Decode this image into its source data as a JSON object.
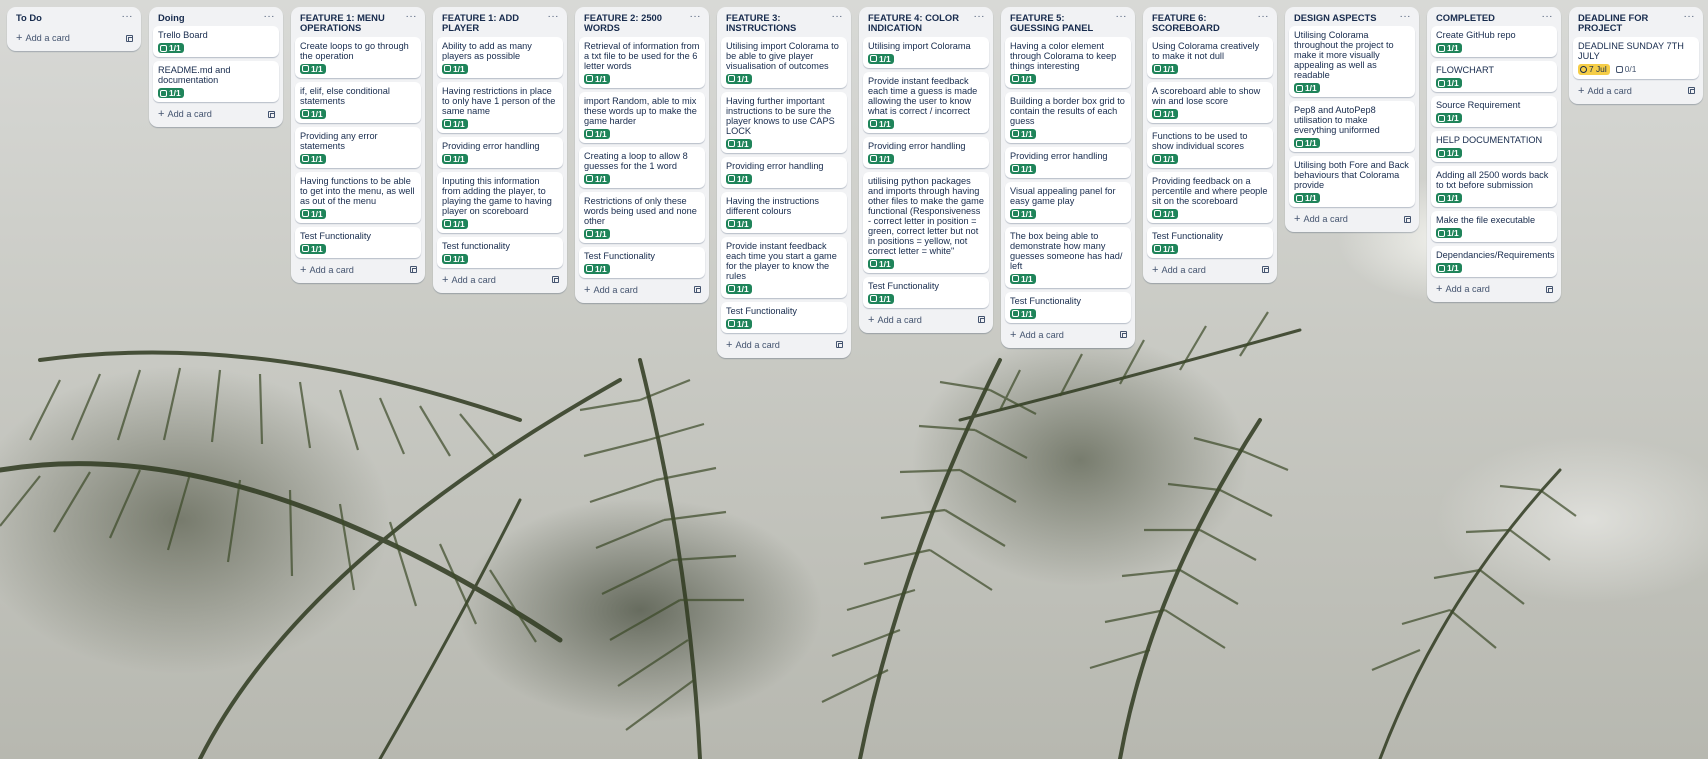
{
  "board": {
    "add_card_label": "Add a card",
    "menu_glyph": "···",
    "lists": [
      {
        "title": "To Do",
        "cards": []
      },
      {
        "title": "Doing",
        "cards": [
          {
            "text": "Trello Board",
            "checklist": "1/1"
          },
          {
            "text": "README.md and documentation",
            "checklist": "1/1"
          }
        ]
      },
      {
        "title": "FEATURE 1: MENU OPERATIONS",
        "cards": [
          {
            "text": "Create loops to go through the operation",
            "checklist": "1/1"
          },
          {
            "text": "if, elif, else conditional statements",
            "checklist": "1/1"
          },
          {
            "text": "Providing any error statements",
            "checklist": "1/1"
          },
          {
            "text": "Having functions to be able to get into the menu, as well as out of the menu",
            "checklist": "1/1"
          },
          {
            "text": "Test Functionality",
            "checklist": "1/1"
          }
        ]
      },
      {
        "title": "FEATURE 1: ADD PLAYER",
        "cards": [
          {
            "text": "Ability to add as many players as possible",
            "checklist": "1/1"
          },
          {
            "text": "Having restrictions in place to only have 1 person of the same name",
            "checklist": "1/1"
          },
          {
            "text": "Providing error handling",
            "checklist": "1/1"
          },
          {
            "text": "Inputing this information from adding the player, to playing the game to having player on scoreboard",
            "checklist": "1/1"
          },
          {
            "text": "Test functionality",
            "checklist": "1/1"
          }
        ]
      },
      {
        "title": "FEATURE 2: 2500 WORDS",
        "cards": [
          {
            "text": "Retrieval of information from a txt file to be used for the 6 letter words",
            "checklist": "1/1"
          },
          {
            "text": "import Random, able to mix these words up to make the game harder",
            "checklist": "1/1"
          },
          {
            "text": "Creating a loop to allow 8 guesses for the 1 word",
            "checklist": "1/1"
          },
          {
            "text": "Restrictions of only these words being used and none other",
            "checklist": "1/1"
          },
          {
            "text": "Test Functionality",
            "checklist": "1/1"
          }
        ]
      },
      {
        "title": "FEATURE 3: INSTRUCTIONS",
        "cards": [
          {
            "text": "Utilising import Colorama to be able to give player visualisation of outcomes",
            "checklist": "1/1"
          },
          {
            "text": "Having further important instructions to be sure the player knows to use CAPS LOCK",
            "checklist": "1/1"
          },
          {
            "text": "Providing error handling",
            "checklist": "1/1"
          },
          {
            "text": "Having the instructions different colours",
            "checklist": "1/1"
          },
          {
            "text": "Provide instant feedback each time you start a game for the player to know the rules",
            "checklist": "1/1"
          },
          {
            "text": "Test Functionality",
            "checklist": "1/1"
          }
        ]
      },
      {
        "title": "FEATURE 4: COLOR INDICATION",
        "cards": [
          {
            "text": "Utilising import Colorama",
            "checklist": "1/1"
          },
          {
            "text": "Provide instant feedback each time a guess is made allowing the user to know what is correct / incorrect",
            "checklist": "1/1"
          },
          {
            "text": "Providing error handling",
            "checklist": "1/1"
          },
          {
            "text": "utilising python packages and imports through having other files to make the game functional (Responsiveness - correct letter in position = green, correct letter but not in positions = yellow, not correct letter = white\"",
            "checklist": "1/1"
          },
          {
            "text": "Test Functionality",
            "checklist": "1/1"
          }
        ]
      },
      {
        "title": "FEATURE 5: GUESSING PANEL",
        "cards": [
          {
            "text": "Having a color element through Colorama to keep things interesting",
            "checklist": "1/1"
          },
          {
            "text": "Building a border box grid to contain the results of each guess",
            "checklist": "1/1"
          },
          {
            "text": "Providing error handling",
            "checklist": "1/1"
          },
          {
            "text": "Visual appealing panel for easy game play",
            "checklist": "1/1"
          },
          {
            "text": "The box being able to demonstrate how many guesses someone has had/ left",
            "checklist": "1/1"
          },
          {
            "text": "Test Functionality",
            "checklist": "1/1"
          }
        ]
      },
      {
        "title": "FEATURE 6: SCOREBOARD",
        "cards": [
          {
            "text": "Using Colorama creatively to make it not dull",
            "checklist": "1/1"
          },
          {
            "text": "A scoreboard able to show win and lose score",
            "checklist": "1/1"
          },
          {
            "text": "Functions to be used to show individual scores",
            "checklist": "1/1"
          },
          {
            "text": "Providing feedback on a percentile and where people sit on the scoreboard",
            "checklist": "1/1"
          },
          {
            "text": "Test Functionality",
            "checklist": "1/1"
          }
        ]
      },
      {
        "title": "DESIGN ASPECTS",
        "cards": [
          {
            "text": "Utilising Colorama throughout the project to make it more visually appealing as well as readable",
            "checklist": "1/1"
          },
          {
            "text": "Pep8 and AutoPep8 utilisation to make everything uniformed",
            "checklist": "1/1"
          },
          {
            "text": "Utilising both Fore and Back behaviours that Colorama provide",
            "checklist": "1/1"
          }
        ]
      },
      {
        "title": "COMPLETED",
        "cards": [
          {
            "text": "Create GitHub repo",
            "checklist": "1/1"
          },
          {
            "text": "FLOWCHART",
            "checklist": "1/1"
          },
          {
            "text": "Source Requirement",
            "checklist": "1/1"
          },
          {
            "text": "HELP DOCUMENTATION",
            "checklist": "1/1"
          },
          {
            "text": "Adding all 2500 words back to txt before submission",
            "checklist": "1/1"
          },
          {
            "text": "Make the file executable",
            "checklist": "1/1"
          },
          {
            "text": "Dependancies/Requirements",
            "checklist": "1/1"
          }
        ]
      },
      {
        "title": "DEADLINE FOR PROJECT",
        "cards": [
          {
            "text": "DEADLINE SUNDAY 7TH JULY",
            "due": "7 Jul",
            "checklist": "0/1",
            "checklist_open": true
          }
        ]
      }
    ]
  },
  "colors": {
    "list_bg": "#f1f2f4",
    "card_bg": "#ffffff",
    "complete_badge": "#1f845a",
    "due_badge": "#f5cd47",
    "text": "#172b4d"
  },
  "icons": {
    "checklist": "checklist-icon",
    "due": "clock-icon",
    "add": "plus-icon",
    "template": "card-template-icon",
    "menu": "ellipsis-icon"
  }
}
